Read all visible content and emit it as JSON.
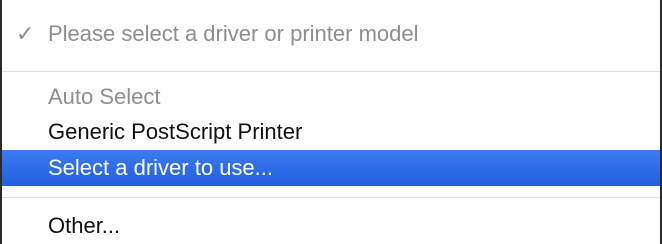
{
  "menu": {
    "items": [
      {
        "label": "Please select a driver or printer model",
        "checkmark": "✓",
        "state": "disabled, checked"
      },
      {
        "label": "Auto Select",
        "state": "disabled"
      },
      {
        "label": "Generic PostScript Printer",
        "state": "enabled"
      },
      {
        "label": "Select a driver to use...",
        "state": "highlighted"
      },
      {
        "label": "Other...",
        "state": "enabled"
      }
    ]
  },
  "colors": {
    "highlight": "#2a66e6",
    "disabled_text": "#8e8e8e",
    "text": "#111111",
    "border": "#2b2b2b"
  }
}
